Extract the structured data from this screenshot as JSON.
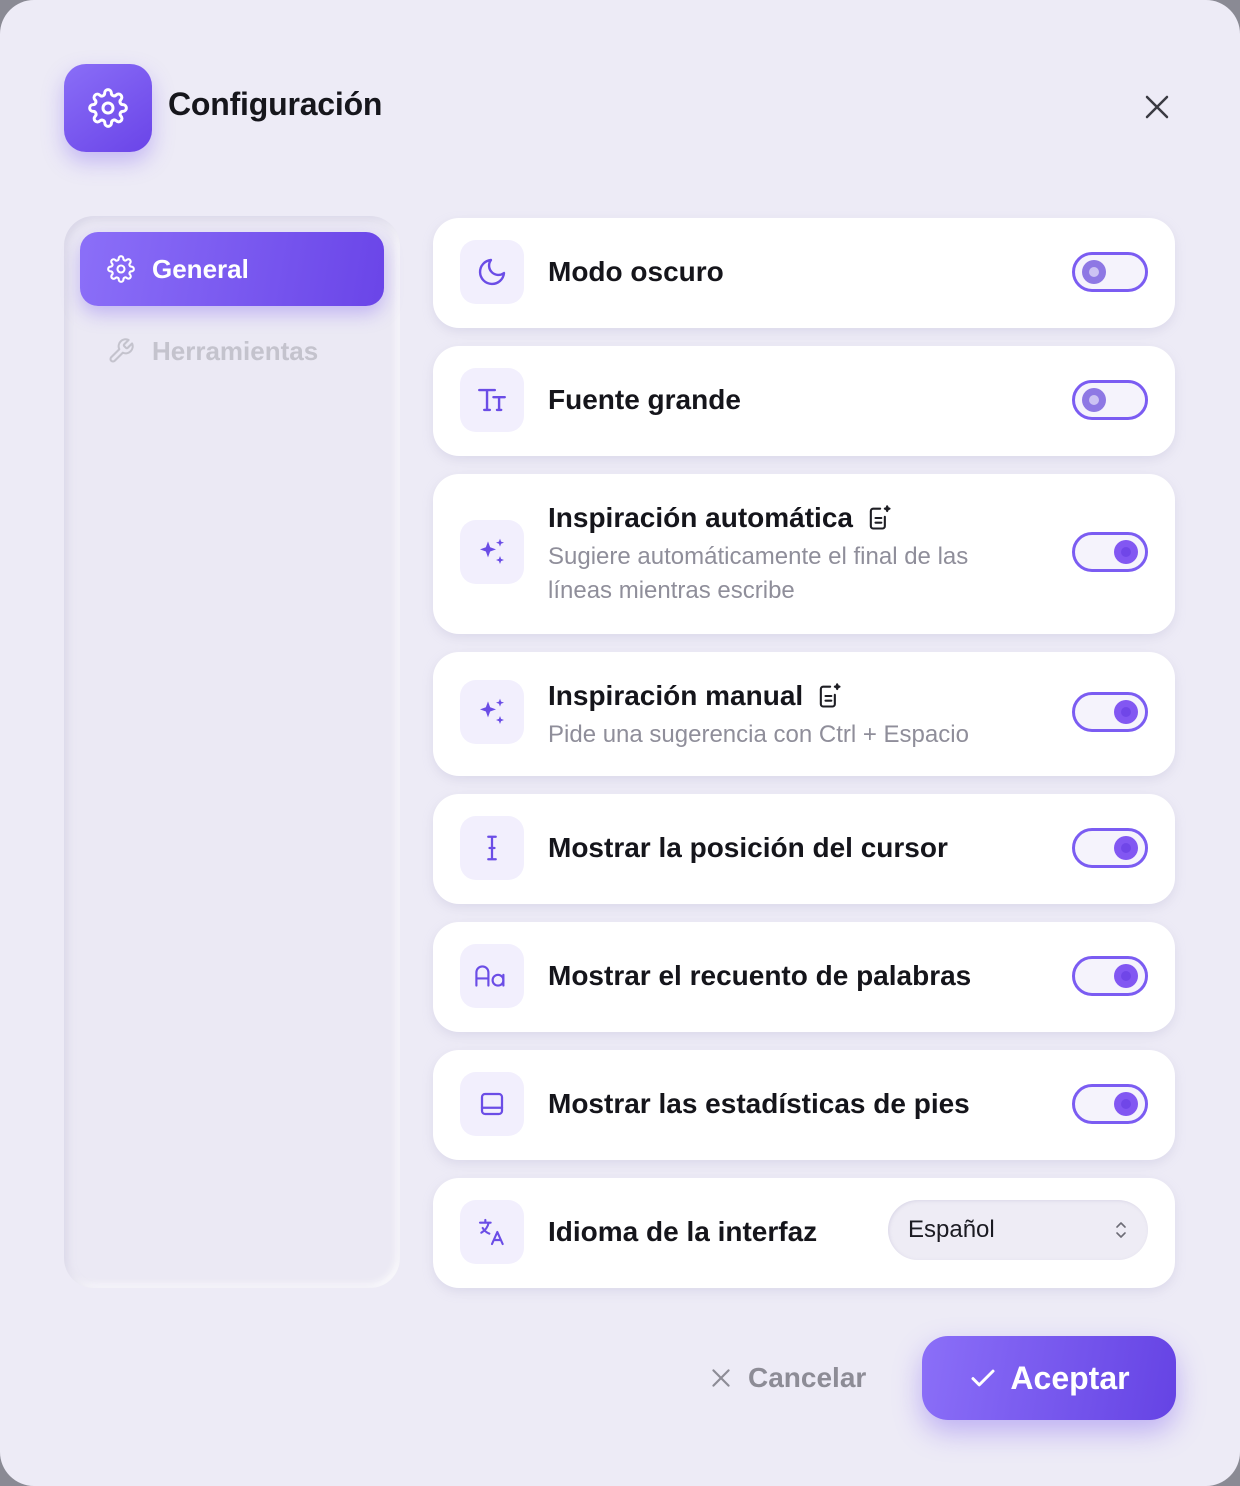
{
  "header": {
    "title": "Configuración",
    "icon": "gear-icon",
    "close_icon": "close-icon"
  },
  "sidebar": {
    "items": [
      {
        "label": "General",
        "icon": "gear-icon",
        "active": true
      },
      {
        "label": "Herramientas",
        "icon": "wrench-icon",
        "active": false
      }
    ]
  },
  "settings": [
    {
      "title": "Modo oscuro",
      "icon": "moon-icon",
      "enabled": false
    },
    {
      "title": "Fuente grande",
      "icon": "text-size-icon",
      "enabled": false
    },
    {
      "title": "Inspiración automática",
      "description": "Sugiere automáticamente el final de las líneas mientras escribe",
      "icon": "sparkles-icon",
      "badge": "ai-document-icon",
      "enabled": true
    },
    {
      "title": "Inspiración manual",
      "description": "Pide una sugerencia con Ctrl + Espacio",
      "icon": "sparkles-icon",
      "badge": "ai-document-icon",
      "enabled": true
    },
    {
      "title": "Mostrar la posición del cursor",
      "icon": "text-cursor-icon",
      "enabled": true
    },
    {
      "title": "Mostrar el recuento de palabras",
      "icon": "font-case-icon",
      "enabled": true
    },
    {
      "title": "Mostrar las estadísticas de pies",
      "icon": "footer-panel-icon",
      "enabled": true
    }
  ],
  "language": {
    "title": "Idioma de la interfaz",
    "icon": "translate-icon",
    "selected": "Español"
  },
  "footer": {
    "cancel_label": "Cancelar",
    "accept_label": "Aceptar"
  },
  "colors": {
    "accent": "#7B5CF2",
    "background": "#EDEBF6",
    "card": "#FFFFFF",
    "muted_text": "#8F8E9A"
  }
}
